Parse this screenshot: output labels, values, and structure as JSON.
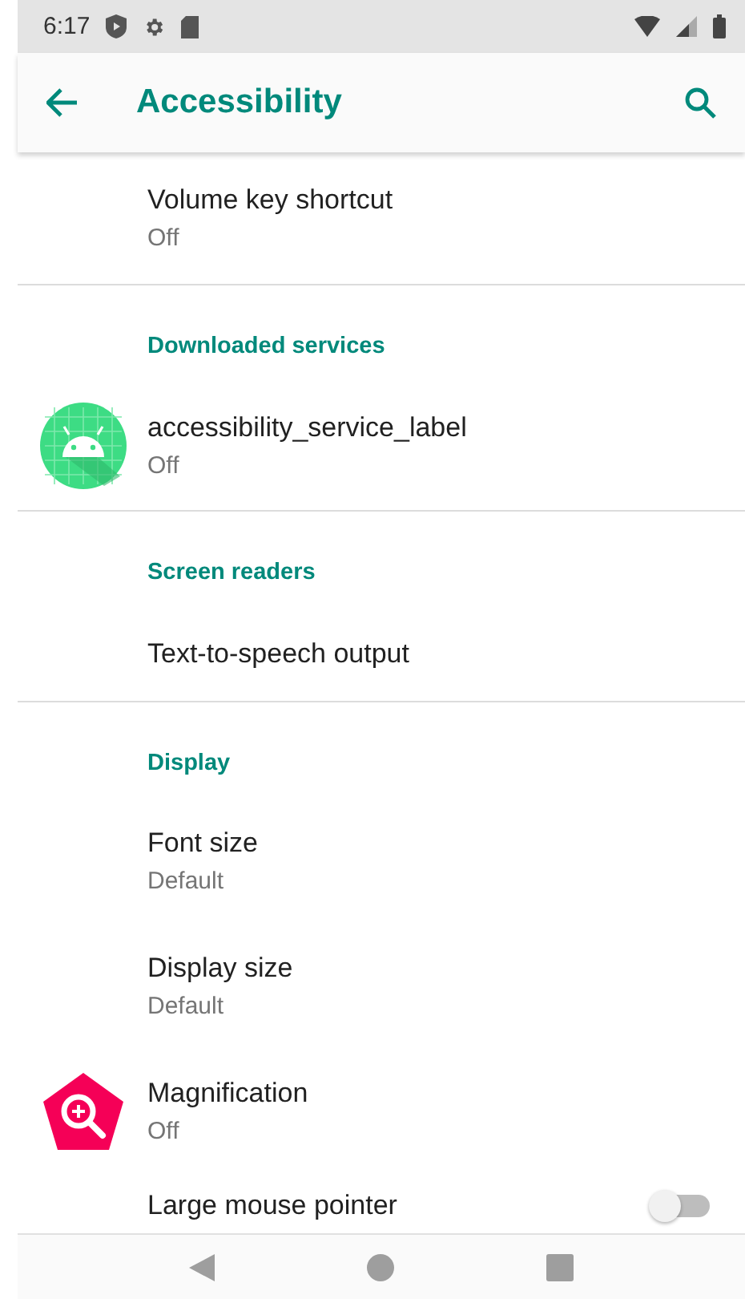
{
  "status_bar": {
    "time": "6:17"
  },
  "app_bar": {
    "title": "Accessibility"
  },
  "sections": [
    {
      "items": [
        {
          "title": "Volume key shortcut",
          "summary": "Off",
          "kind": "plain"
        }
      ]
    },
    {
      "header": "Downloaded services",
      "items": [
        {
          "title": "accessibility_service_label",
          "summary": "Off",
          "kind": "android"
        }
      ]
    },
    {
      "header": "Screen readers",
      "items": [
        {
          "title": "Text-to-speech output",
          "kind": "plain"
        }
      ]
    },
    {
      "header": "Display",
      "items": [
        {
          "title": "Font size",
          "summary": "Default",
          "kind": "plain"
        },
        {
          "title": "Display size",
          "summary": "Default",
          "kind": "plain"
        },
        {
          "title": "Magnification",
          "summary": "Off",
          "kind": "magnifier"
        },
        {
          "title": "Large mouse pointer",
          "kind": "toggle",
          "checked": false
        }
      ]
    }
  ]
}
